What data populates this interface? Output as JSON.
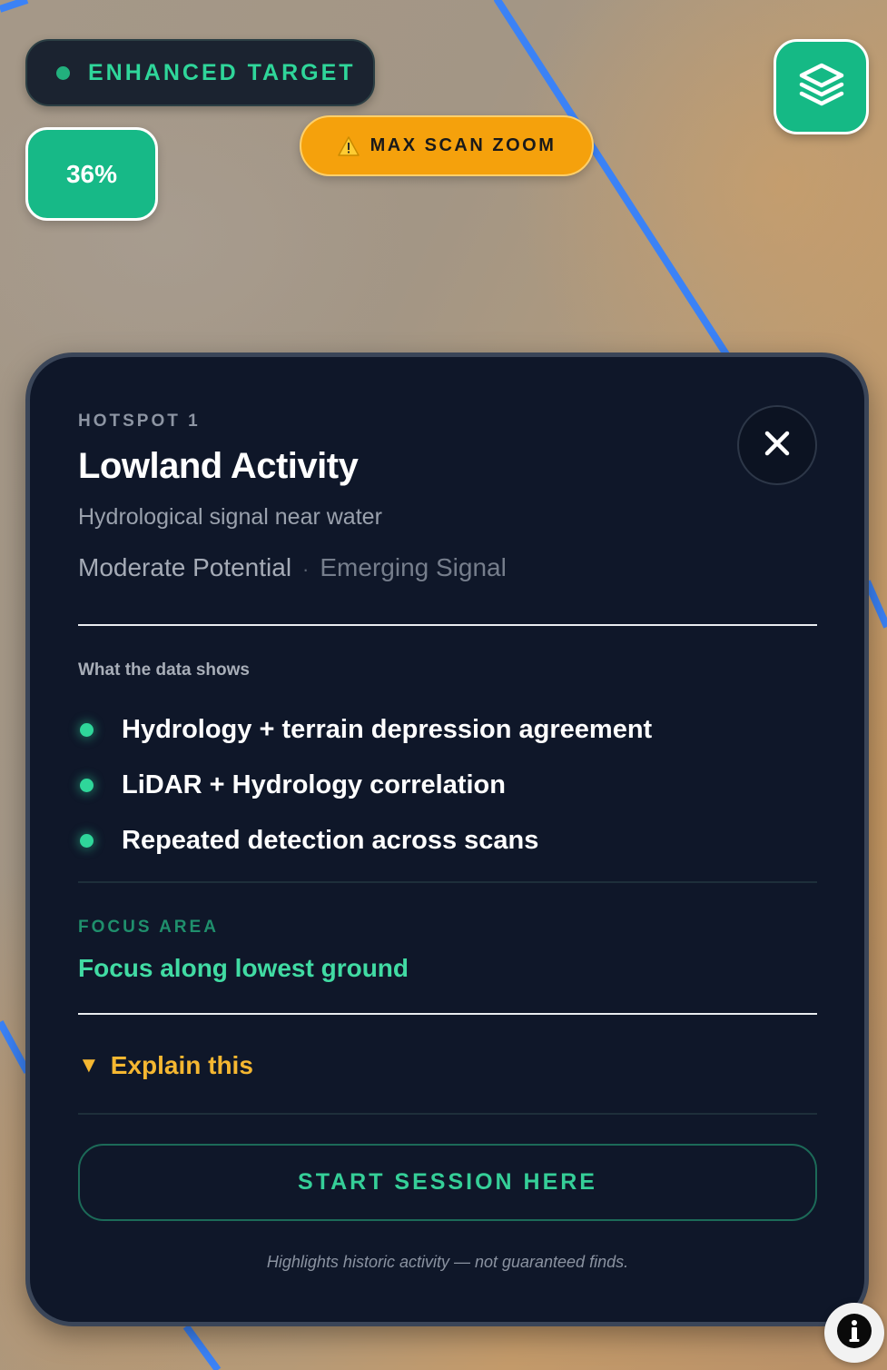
{
  "badges": {
    "enhanced_target": "ENHANCED TARGET",
    "zoom_percent": "36%",
    "warning": "MAX SCAN ZOOM"
  },
  "icons": {
    "layers": "layers-icon",
    "close": "close-icon",
    "warning": "warning-icon",
    "info": "info-icon"
  },
  "colors": {
    "accent_green": "#17b987",
    "warning_orange": "#f5a10c",
    "panel_bg": "#0f1729",
    "explain_yellow": "#f5b731",
    "route_blue": "#3b82f6"
  },
  "hotspot": {
    "eyebrow": "HOTSPOT 1",
    "title": "Lowland Activity",
    "subtitle": "Hydrological signal near water",
    "potential": "Moderate Potential",
    "separator": "·",
    "signal": "Emerging Signal",
    "data_heading": "What the data shows",
    "data_points": [
      "Hydrology + terrain depression agreement",
      "LiDAR + Hydrology correlation",
      "Repeated detection across scans"
    ],
    "focus_label": "FOCUS AREA",
    "focus_text": "Focus along lowest ground",
    "explain_label": "Explain this",
    "explain_triangle": "▼",
    "start_button": "START SESSION HERE",
    "disclaimer": "Highlights historic activity — not guaranteed finds."
  }
}
